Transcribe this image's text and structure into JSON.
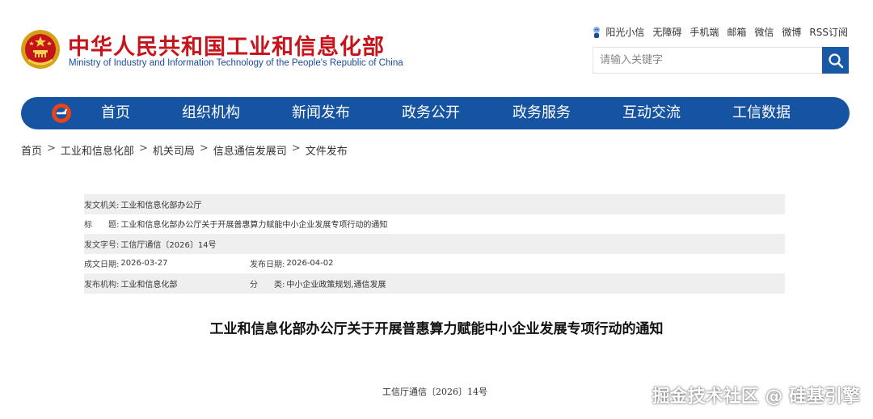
{
  "header": {
    "title": "中华人民共和国工业和信息化部",
    "subtitle": "Ministry of Industry and Information Technology of the People's Republic of China",
    "top_links": [
      "阳光小信",
      "无障碍",
      "手机端",
      "邮箱",
      "微信",
      "微博",
      "RSS订阅"
    ],
    "search_placeholder": "请输入关键字"
  },
  "nav": {
    "items": [
      "首页",
      "组织机构",
      "新闻发布",
      "政务公开",
      "政务服务",
      "互动交流",
      "工信数据"
    ]
  },
  "breadcrumb": [
    "首页",
    "工业和信息化部",
    "机关司局",
    "信息通信发展司",
    "文件发布"
  ],
  "breadcrumb_separator": ">",
  "info": {
    "issuer_label": "发文机关:",
    "issuer": "工业和信息化部办公厅",
    "title_label": "标　　题:",
    "title": "工业和信息化部办公厅关于开展普惠算力赋能中小企业发展专项行动的通知",
    "docno_label": "发文字号:",
    "docno": "工信厅通信〔2026〕14号",
    "written_label": "成文日期:",
    "written_date": "2026-03-27",
    "published_label": "发布日期:",
    "published_date": "2026-04-02",
    "publisher_label": "发布机构:",
    "publisher": "工业和信息化部",
    "category_label": "分　　类:",
    "category": "中小企业政策规划,通信发展"
  },
  "article": {
    "title": "工业和信息化部办公厅关于开展普惠算力赋能中小企业发展专项行动的通知",
    "doc_number": "工信厅通信〔2026〕14号"
  },
  "watermark": "掘金技术社区 @ 硅基引擎",
  "colors": {
    "brand_red": "#c7141b",
    "nav_blue": "#1653a1",
    "search_blue": "#1859a6",
    "row_shade": "#efefef"
  },
  "icons": {
    "emblem": "national-emblem-icon",
    "nav_logo": "miit-logo-icon",
    "search": "search-icon",
    "sunshine": "sunshine-xiaoxin-icon"
  }
}
